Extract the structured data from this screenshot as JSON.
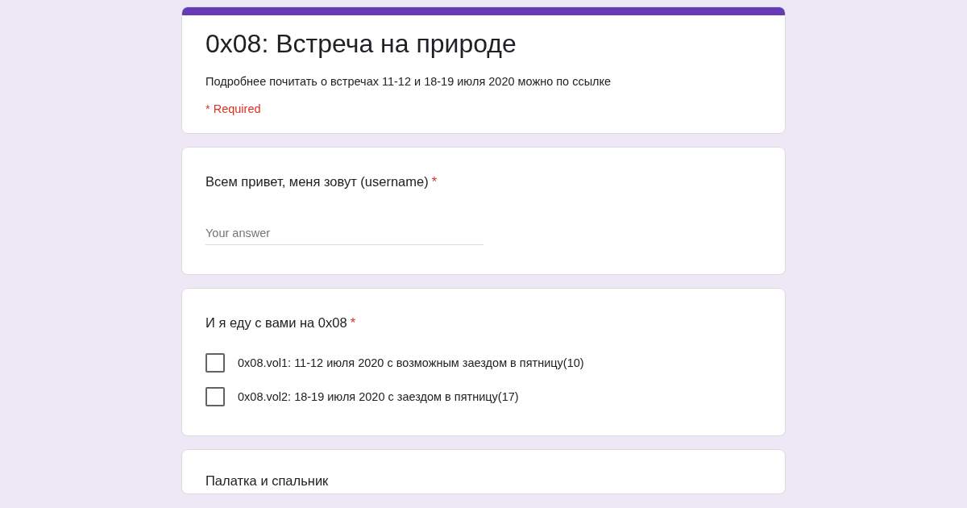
{
  "header": {
    "title": "0x08: Встреча на природе",
    "description": "Подробнее почитать о встречах 11-12 и 18-19 июля 2020 можно по ссылке",
    "required_note": "* Required"
  },
  "questions": [
    {
      "kind": "text",
      "title": "Всем привет, меня зовут (username)",
      "required_mark": "*",
      "placeholder": "Your answer"
    },
    {
      "kind": "checkbox",
      "title": "И я еду с вами на 0x08",
      "required_mark": "*",
      "options": [
        {
          "label": "0x08.vol1: 11-12 июля 2020 с возможным заездом в пятницу(10)",
          "checked": false
        },
        {
          "label": "0x08.vol2: 18-19 июля 2020 с заездом в пятницу(17)",
          "checked": false
        }
      ]
    },
    {
      "kind": "heading",
      "title": "Палатка и спальник"
    }
  ]
}
